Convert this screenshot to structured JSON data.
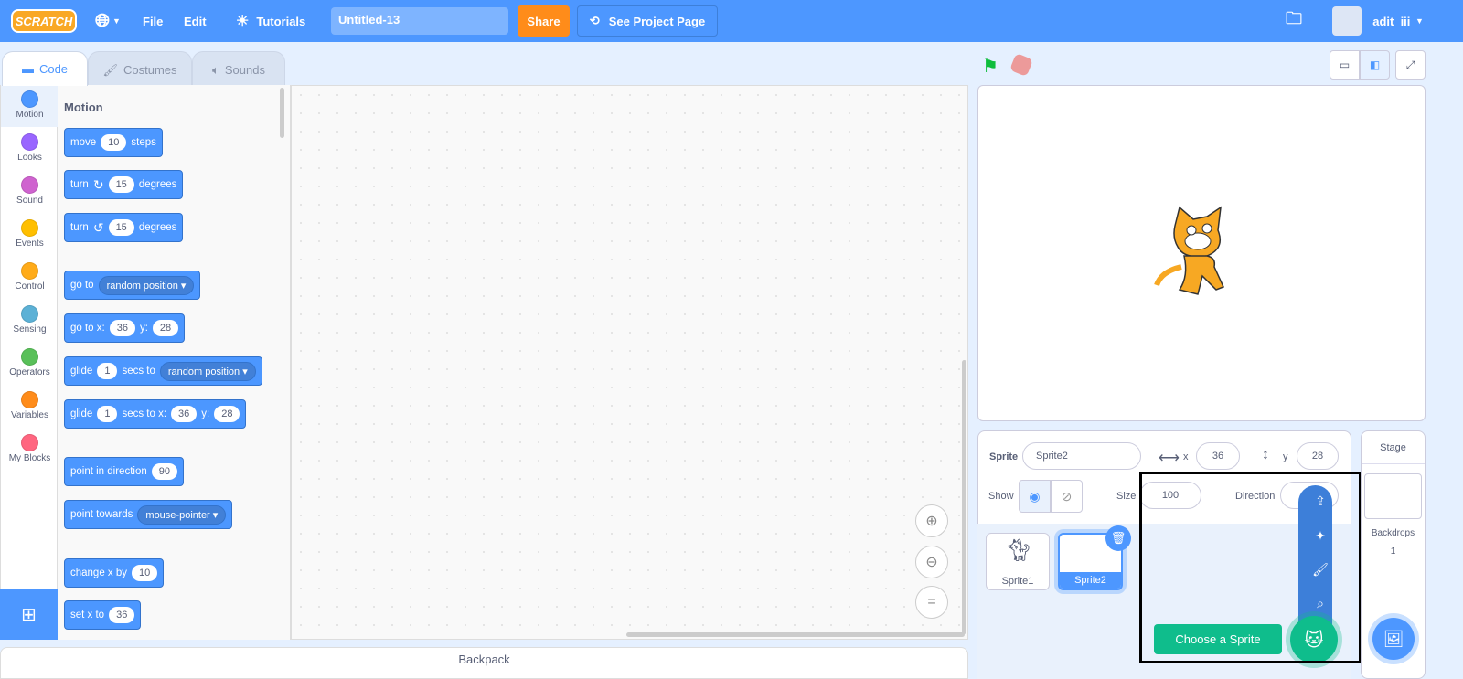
{
  "topbar": {
    "logo": "SCRATCH",
    "language_icon": "globe-icon",
    "file": "File",
    "edit": "Edit",
    "tutorials": "Tutorials",
    "project_title": "Untitled-13",
    "share": "Share",
    "see_project_page": "See Project Page",
    "username": "_adit_iii"
  },
  "tabs": [
    {
      "label": "Code"
    },
    {
      "label": "Costumes"
    },
    {
      "label": "Sounds"
    }
  ],
  "categories": [
    {
      "label": "Motion",
      "color": "#4c97ff"
    },
    {
      "label": "Looks",
      "color": "#9966ff"
    },
    {
      "label": "Sound",
      "color": "#cf63cf"
    },
    {
      "label": "Events",
      "color": "#ffbf00"
    },
    {
      "label": "Control",
      "color": "#ffab19"
    },
    {
      "label": "Sensing",
      "color": "#5cb1d6"
    },
    {
      "label": "Operators",
      "color": "#59c059"
    },
    {
      "label": "Variables",
      "color": "#ff8c1a"
    },
    {
      "label": "My Blocks",
      "color": "#ff6680"
    }
  ],
  "palette": {
    "heading": "Motion",
    "blocks": {
      "move": {
        "a": "move",
        "v": "10",
        "b": "steps"
      },
      "turn_right": {
        "a": "turn",
        "v": "15",
        "b": "degrees"
      },
      "turn_left": {
        "a": "turn",
        "v": "15",
        "b": "degrees"
      },
      "goto": {
        "a": "go to",
        "d": "random position"
      },
      "goto_xy": {
        "a": "go to x:",
        "x": "36",
        "b": "y:",
        "y": "28"
      },
      "glide": {
        "a": "glide",
        "v": "1",
        "b": "secs to",
        "d": "random position"
      },
      "glide_xy": {
        "a": "glide",
        "v": "1",
        "b": "secs to x:",
        "x": "36",
        "c": "y:",
        "y": "28"
      },
      "point_dir": {
        "a": "point in direction",
        "v": "90"
      },
      "point_towards": {
        "a": "point towards",
        "d": "mouse-pointer"
      },
      "change_x": {
        "a": "change x by",
        "v": "10"
      },
      "set_x": {
        "a": "set x to",
        "v": "36"
      }
    }
  },
  "backpack": "Backpack",
  "sprite_info": {
    "sprite_label": "Sprite",
    "sprite_name": "Sprite2",
    "x_label": "x",
    "x": "36",
    "y_label": "y",
    "y": "28",
    "show_label": "Show",
    "size_label": "Size",
    "size": "100",
    "direction_label": "Direction"
  },
  "sprites": [
    {
      "name": "Sprite1"
    },
    {
      "name": "Sprite2",
      "selected": true
    }
  ],
  "stage_panel": {
    "title": "Stage",
    "backdrops_label": "Backdrops",
    "backdrops_count": "1"
  },
  "sprite_menu": {
    "tooltip": "Choose a Sprite",
    "items": [
      "upload-icon",
      "surprise-icon",
      "paint-icon",
      "search-icon"
    ]
  },
  "colors": {
    "accent": "#4d97ff",
    "share": "#ff8c1a",
    "choose": "#0fbd8c"
  }
}
